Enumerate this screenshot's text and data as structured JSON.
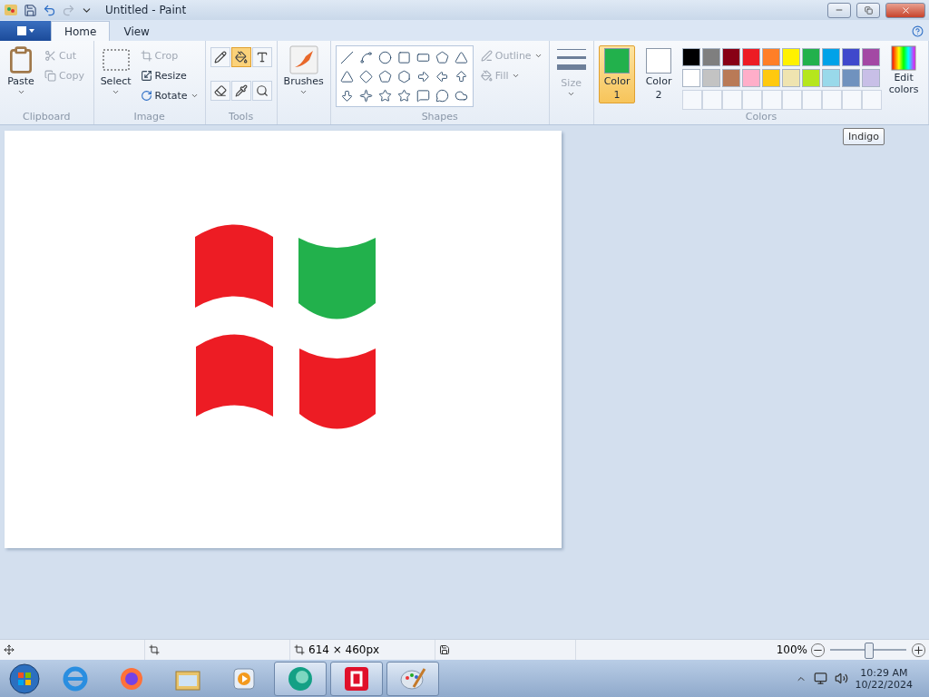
{
  "window": {
    "title": "Untitled - Paint"
  },
  "tabs": [
    {
      "label": "Home",
      "selected": true
    },
    {
      "label": "View",
      "selected": false
    }
  ],
  "clipboard": {
    "paste": "Paste",
    "cut": {
      "label": "Cut",
      "disabled": true
    },
    "copy": {
      "label": "Copy",
      "disabled": true
    },
    "group": "Clipboard"
  },
  "image": {
    "select": "Select",
    "crop": {
      "label": "Crop",
      "disabled": true
    },
    "resize": {
      "label": "Resize",
      "disabled": false
    },
    "rotate": {
      "label": "Rotate",
      "disabled": false
    },
    "group": "Image"
  },
  "tools": {
    "group": "Tools",
    "items": [
      {
        "kind": "pencil",
        "selected": false
      },
      {
        "kind": "fill",
        "selected": true
      },
      {
        "kind": "text",
        "selected": false
      },
      {
        "kind": "eraser",
        "selected": false
      },
      {
        "kind": "picker",
        "selected": false
      },
      {
        "kind": "magnifier",
        "selected": false
      }
    ]
  },
  "brushes": {
    "label": "Brushes"
  },
  "shapes": {
    "group": "Shapes",
    "outline": {
      "label": "Outline",
      "disabled": true
    },
    "fill": {
      "label": "Fill",
      "disabled": true
    }
  },
  "size": {
    "label": "Size",
    "disabled": true
  },
  "colors": {
    "group": "Colors",
    "color1": {
      "label": "Color",
      "number": "1",
      "color": "#22b14c",
      "selected": true
    },
    "color2": {
      "label": "Color",
      "number": "2",
      "color": "#ffffff",
      "selected": false
    },
    "palette": [
      {
        "color": "#000000"
      },
      {
        "color": "#7f7f7f"
      },
      {
        "color": "#880015"
      },
      {
        "color": "#ed1c24"
      },
      {
        "color": "#ff7f27"
      },
      {
        "color": "#fff200"
      },
      {
        "color": "#22b14c"
      },
      {
        "color": "#00a2e8"
      },
      {
        "color": "#3f48cc"
      },
      {
        "color": "#a349a4"
      },
      {
        "color": "#ffffff"
      },
      {
        "color": "#c3c3c3"
      },
      {
        "color": "#b97a57"
      },
      {
        "color": "#ffaec9"
      },
      {
        "color": "#ffc90e"
      },
      {
        "color": "#efe4b0"
      },
      {
        "color": "#b5e61d"
      },
      {
        "color": "#99d9ea"
      },
      {
        "color": "#7092be"
      },
      {
        "color": "#c8bfe7"
      }
    ],
    "edit": "Edit colors",
    "tooltip": "Indigo"
  },
  "status_bar": {
    "size": "614 × 460px",
    "zoom": "100%",
    "zoom_level": {
      "level": 0.5
    }
  },
  "taskbar": {
    "time": "10:29 AM",
    "date": "10/22/2024"
  }
}
